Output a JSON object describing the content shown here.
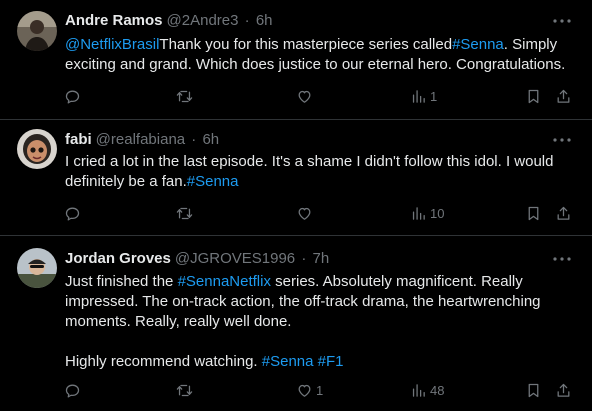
{
  "tweets": [
    {
      "name": "Andre Ramos",
      "handle": "@2Andre3",
      "dot": "·",
      "time": "6h",
      "mention": "@NetflixBrasil",
      "t1": "Thank you for this masterpiece series called",
      "hashtag1": "#Senna",
      "t2": ". Simply exciting and grand. Which does justice to our eternal hero. Congratulations.",
      "views": "1",
      "likes": ""
    },
    {
      "name": "fabi",
      "handle": "@realfabiana",
      "dot": "·",
      "time": "6h",
      "t1": "I cried a lot in the last episode. It's a shame I didn't follow this idol. I would definitely be a fan.",
      "hashtag1": "#Senna",
      "views": "10",
      "likes": ""
    },
    {
      "name": "Jordan Groves",
      "handle": "@JGROVES1996",
      "dot": "·",
      "time": "7h",
      "t1": "Just finished the ",
      "hashtag1": "#SennaNetflix",
      "t2": " series. Absolutely magnificent. Really impressed. The on-track action, the off-track drama, the heartwrenching moments. Really, really well done.",
      "t3": "Highly recommend watching. ",
      "hashtag2": "#Senna",
      "hashtag3": "#F1",
      "views": "48",
      "likes": "1"
    }
  ],
  "colors": {
    "background": "#000000",
    "text": "#e7e9ea",
    "muted": "#71767b",
    "link": "#1d9bf0",
    "divider": "#2f3336"
  },
  "icons": [
    "more-icon",
    "reply-icon",
    "retweet-icon",
    "like-icon",
    "views-icon",
    "bookmark-icon",
    "share-icon"
  ]
}
